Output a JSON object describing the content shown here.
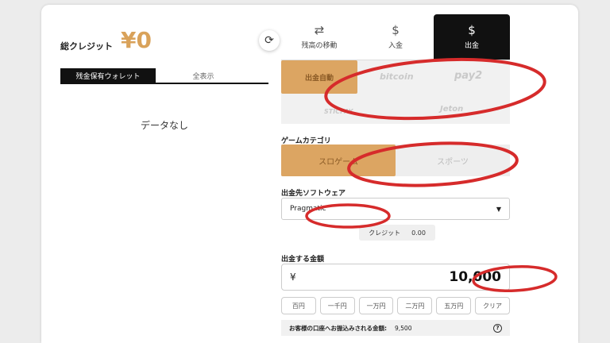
{
  "left": {
    "credit_label": "総クレジット",
    "credit_value": "¥0",
    "wallet_tabs": [
      "残金保有ウォレット",
      "全表示"
    ],
    "no_data": "データなし"
  },
  "tabs": [
    {
      "label": "残高の移動",
      "icon": "transfer-arrows-icon"
    },
    {
      "label": "入金",
      "icon": "dollar-down-icon"
    },
    {
      "label": "出金",
      "icon": "dollar-search-icon"
    }
  ],
  "methods": [
    "出金自動",
    "bitcoin",
    "pay2",
    "STICPAY",
    "Jeton"
  ],
  "game_category": {
    "label": "ゲームカテゴリ",
    "options": [
      "スロゲーム",
      "スポーツ"
    ]
  },
  "software": {
    "label": "出金先ソフトウェア",
    "selected": "Pragmatic",
    "credit_label": "クレジット",
    "credit_value": "0.00"
  },
  "amount": {
    "label": "出金する金額",
    "currency": "¥",
    "value": "10,000"
  },
  "quick_amounts": [
    "百円",
    "一千円",
    "一万円",
    "二万円",
    "五万円",
    "クリア"
  ],
  "received": {
    "label": "お客様の口座へお振込みされる金額:",
    "value": "9,500",
    "help": "?"
  },
  "colors": {
    "accent": "#dca562",
    "annotation": "#d62b2b"
  }
}
